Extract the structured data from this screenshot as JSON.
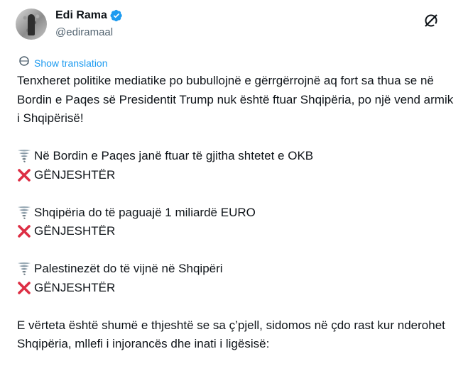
{
  "author": {
    "display_name": "Edi Rama",
    "handle": "@ediramaal",
    "verified_icon": "verified-badge-icon"
  },
  "actions": {
    "grok_icon": "grok-icon"
  },
  "translation": {
    "label": "Show translation",
    "icon": "translate-icon"
  },
  "tweet": {
    "intro": "Tenxheret politike mediatike po bubullojnë e gërrgërrojnë aq fort sa thua se në Bordin e Paqes së Presidentit Trump nuk është ftuar Shqipëria, po një vend armik i Shqipërisë!",
    "claims": [
      {
        "icon": "tornado-icon",
        "text": "Në Bordin e Paqes janë ftuar të gjitha shtetet e OKB",
        "verdict_icon": "cross-mark-icon",
        "verdict": "GËNJESHTËR"
      },
      {
        "icon": "tornado-icon",
        "text": "Shqipëria do të paguajë 1 miliardë EURO",
        "verdict_icon": "cross-mark-icon",
        "verdict": "GËNJESHTËR"
      },
      {
        "icon": "tornado-icon",
        "text": "Palestinezët do të vijnë në Shqipëri",
        "verdict_icon": "cross-mark-icon",
        "verdict": "GËNJESHTËR"
      }
    ],
    "closing": "E vërteta është shumë e thjeshtë se sa ç’pjell, sidomos në çdo rast kur nderohet Shqipëria, mllefi i injorancës dhe inati i ligësisë:"
  },
  "colors": {
    "text": "#0f1419",
    "secondary": "#536471",
    "link": "#1d9bf0",
    "cross": "#dd2e44"
  }
}
